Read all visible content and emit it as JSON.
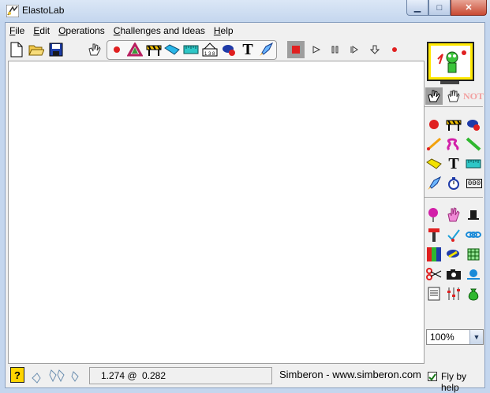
{
  "window": {
    "title": "ElastoLab"
  },
  "menu": [
    "File",
    "Edit",
    "Operations",
    "Challenges and Ideas",
    "Help"
  ],
  "toolbar": {
    "file_buttons": [
      "new-file-icon",
      "open-folder-icon",
      "save-disk-icon"
    ],
    "tool_buttons": [
      "ball-icon",
      "triangle-icon",
      "barrier-icon",
      "ramp-icon",
      "ruler-icon",
      "scale-icon",
      "cannon-icon",
      "text-tool-icon",
      "rocket-icon"
    ],
    "sim_controls": [
      "stop-icon",
      "play-icon",
      "pause-icon",
      "step-icon",
      "reset-icon",
      "record-icon"
    ],
    "text_tool_glyph": "T"
  },
  "palette": {
    "rows": [
      [
        "ball-icon",
        "barrier-icon",
        "cannon-icon"
      ],
      [
        "spring-icon",
        "coil-icon",
        "rod-icon"
      ],
      [
        "ramp-icon",
        "text-tool-icon",
        "ruler-icon"
      ],
      [
        "rocket-icon",
        "stopwatch-icon",
        "counter-icon"
      ],
      [
        "balloon-icon",
        "hand-icon",
        "hat-icon"
      ],
      [
        "hammer-icon",
        "check-icon",
        "chain-icon"
      ],
      [
        "colors-icon",
        "fish-icon",
        "grid-icon"
      ],
      [
        "scissors-icon",
        "camera-icon",
        "snail-icon"
      ],
      [
        "scroll-icon",
        "sliders-icon",
        "money-bag-icon"
      ]
    ],
    "text_glyph": "T",
    "counter_glyph": "000",
    "no_label": "NOT"
  },
  "zoom": {
    "value": "100%"
  },
  "status": {
    "help_glyph": "?",
    "coord_x": "1.274 @",
    "coord_y": "0.282",
    "credit": "Simberon - www.simberon.com",
    "fly_by_help_label": "Fly by help",
    "fly_by_help_checked": true
  },
  "colors": {
    "titlebar": "#c4d6ee",
    "canvas": "#ffffff",
    "accent_red": "#e02020",
    "stop_button_bg": "#9e9e9e"
  }
}
